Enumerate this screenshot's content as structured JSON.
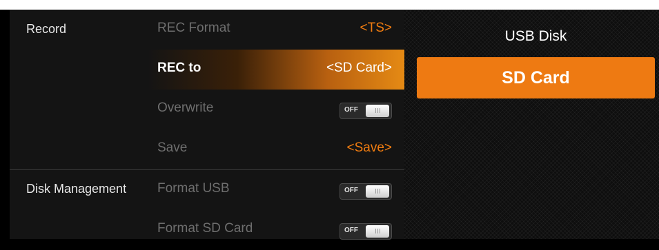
{
  "settings": {
    "sections": [
      {
        "label": "Record"
      },
      {
        "label": "Disk Management"
      }
    ],
    "rows": [
      {
        "label": "REC Format",
        "value": "<TS>"
      },
      {
        "label": "REC to",
        "value": "<SD Card>"
      },
      {
        "label": "Overwrite",
        "toggle": "OFF"
      },
      {
        "label": "Save",
        "value": "<Save>"
      },
      {
        "label": "Format USB",
        "toggle": "OFF"
      },
      {
        "label": "Format SD Card",
        "toggle": "OFF"
      }
    ],
    "selected_row": "REC to"
  },
  "options_panel": {
    "items": [
      {
        "label": "USB Disk"
      },
      {
        "label": "SD Card",
        "selected": true
      }
    ]
  },
  "colors": {
    "accent": "#ee7a12",
    "value_text": "#f07c10",
    "panel_bg": "#141414"
  }
}
